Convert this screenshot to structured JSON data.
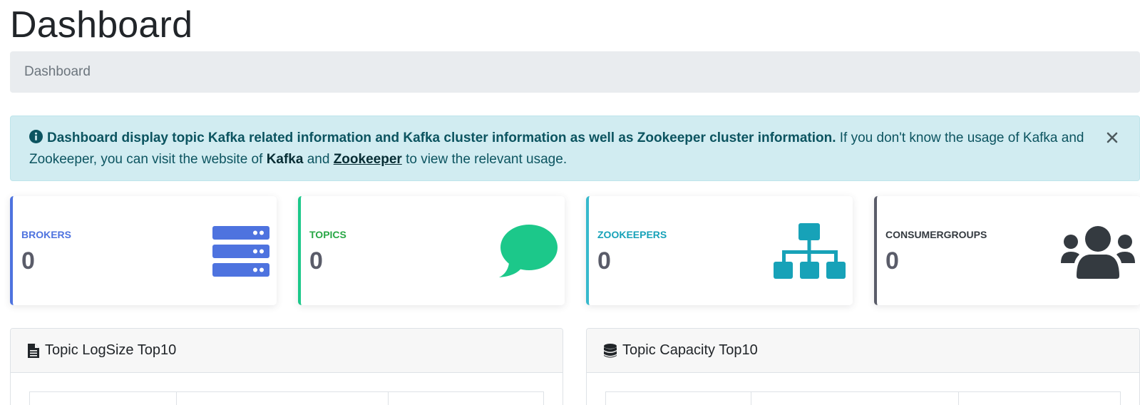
{
  "page": {
    "title": "Dashboard"
  },
  "breadcrumb": {
    "items": [
      "Dashboard"
    ]
  },
  "alert": {
    "bold_text": "Dashboard display topic Kafka related information and Kafka cluster information as well as Zookeeper cluster information.",
    "text_1": " If you don't know the usage of Kafka and Zookeeper, you can visit the website of ",
    "link_kafka": "Kafka",
    "text_2": " and ",
    "link_zookeeper": "Zookeeper",
    "text_3": " to view the relevant usage.",
    "icon": "info-circle-icon",
    "close_icon": "close-icon"
  },
  "cards": [
    {
      "label": "BROKERS",
      "value": "0",
      "color": "#4e73df",
      "icon": "server-icon"
    },
    {
      "label": "TOPICS",
      "value": "0",
      "color": "#1cc88a",
      "icon": "comment-icon"
    },
    {
      "label": "ZOOKEEPERS",
      "value": "0",
      "color": "#17a2b8",
      "icon": "sitemap-icon"
    },
    {
      "label": "CONSUMERGROUPS",
      "value": "0",
      "color": "#343a40",
      "icon": "users-icon"
    }
  ],
  "panels": [
    {
      "title": "Topic LogSize Top10",
      "icon": "file-text-icon"
    },
    {
      "title": "Topic Capacity Top10",
      "icon": "database-icon"
    }
  ]
}
